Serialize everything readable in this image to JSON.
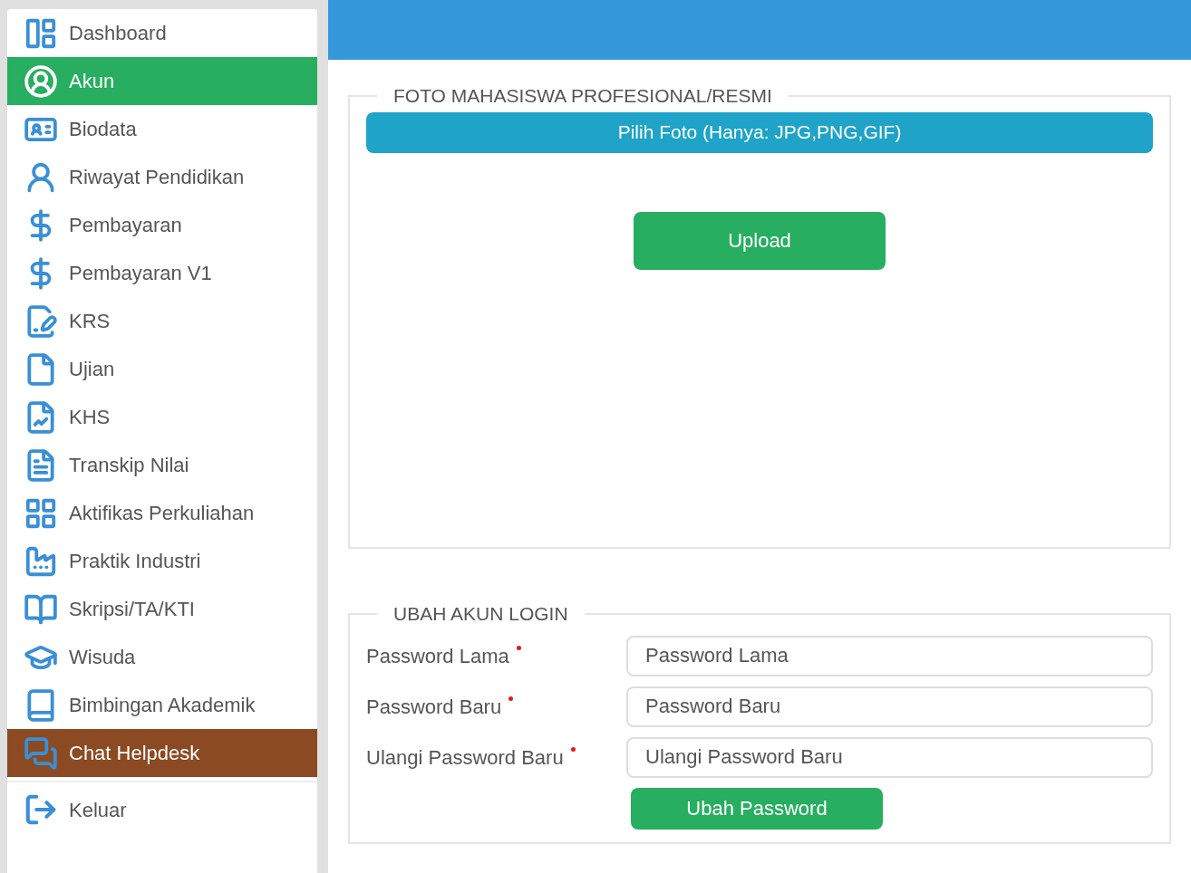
{
  "sidebar": {
    "items": [
      {
        "label": "Dashboard",
        "selected": false,
        "kind": "normal"
      },
      {
        "label": "Akun",
        "selected": true,
        "kind": "normal"
      },
      {
        "label": "Biodata",
        "selected": false,
        "kind": "normal"
      },
      {
        "label": "Riwayat Pendidikan",
        "selected": false,
        "kind": "normal"
      },
      {
        "label": "Pembayaran",
        "selected": false,
        "kind": "normal"
      },
      {
        "label": "Pembayaran V1",
        "selected": false,
        "kind": "normal"
      },
      {
        "label": "KRS",
        "selected": false,
        "kind": "normal"
      },
      {
        "label": "Ujian",
        "selected": false,
        "kind": "normal"
      },
      {
        "label": "KHS",
        "selected": false,
        "kind": "normal"
      },
      {
        "label": "Transkip Nilai",
        "selected": false,
        "kind": "normal"
      },
      {
        "label": "Aktifikas Perkuliahan",
        "selected": false,
        "kind": "normal"
      },
      {
        "label": "Praktik Industri",
        "selected": false,
        "kind": "normal"
      },
      {
        "label": "Skripsi/TA/KTI",
        "selected": false,
        "kind": "normal"
      },
      {
        "label": "Wisuda",
        "selected": false,
        "kind": "normal"
      },
      {
        "label": "Bimbingan Akademik",
        "selected": false,
        "kind": "normal"
      },
      {
        "label": "Chat Helpdesk",
        "selected": false,
        "kind": "highlight"
      }
    ],
    "logout": {
      "label": "Keluar"
    }
  },
  "photo_section": {
    "title": "FOTO MAHASISWA PROFESIONAL/RESMI",
    "choose_button": "Pilih Foto (Hanya: JPG,PNG,GIF)",
    "upload_button": "Upload"
  },
  "account_section": {
    "title": "UBAH AKUN LOGIN",
    "fields": [
      {
        "label": "Password Lama",
        "required": true,
        "placeholder": "Password Lama"
      },
      {
        "label": "Password Baru",
        "required": true,
        "placeholder": "Password Baru"
      },
      {
        "label": "Ulangi Password Baru",
        "required": true,
        "placeholder": "Ulangi Password Baru"
      }
    ],
    "submit_button": "Ubah Password"
  }
}
